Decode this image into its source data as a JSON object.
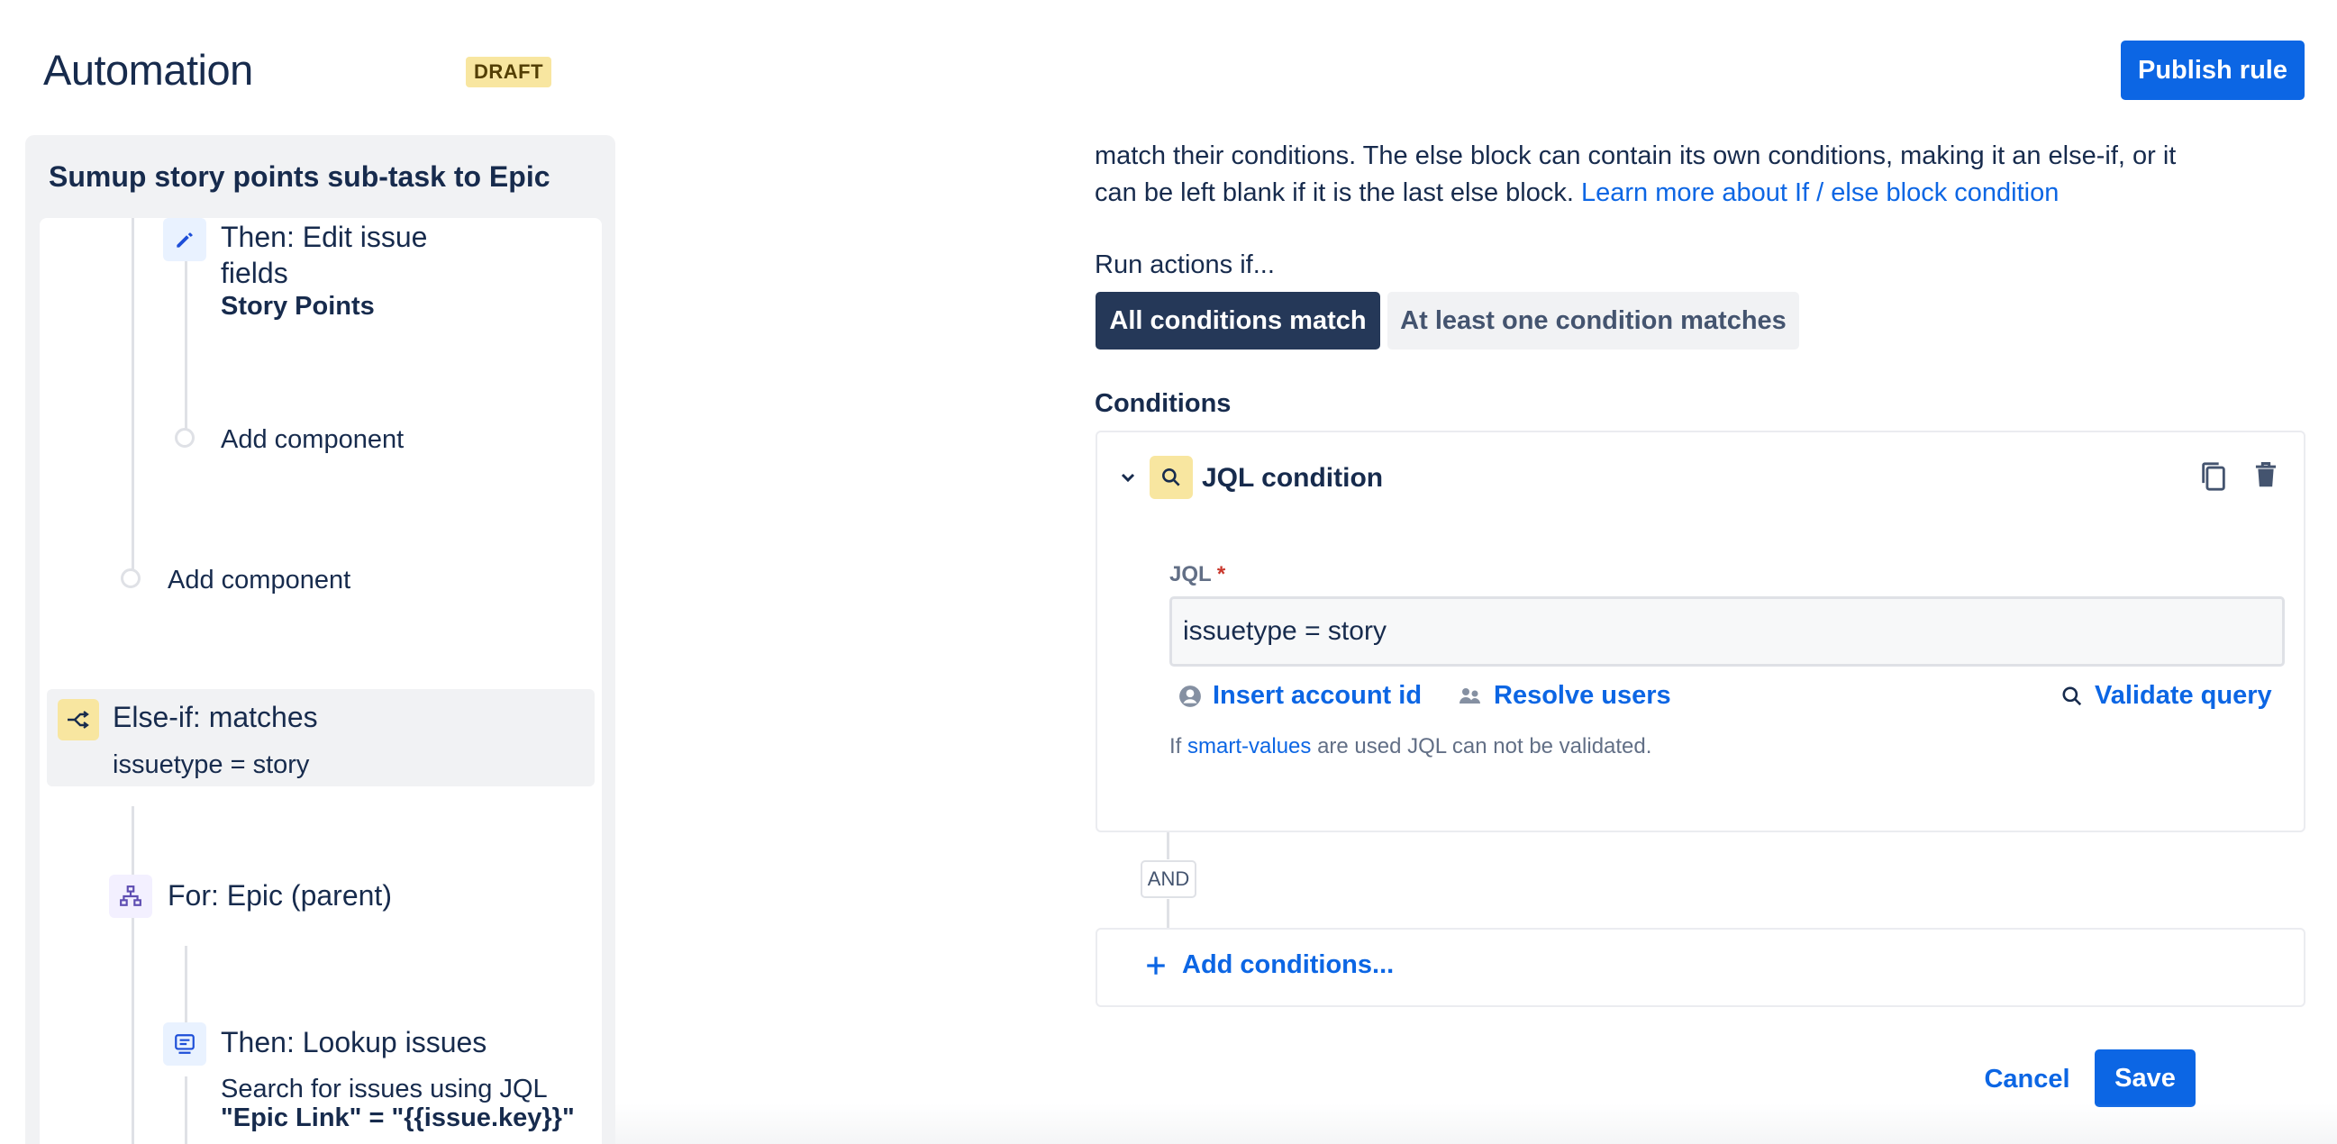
{
  "header": {
    "title": "Automation",
    "status_badge": "DRAFT",
    "publish_label": "Publish rule"
  },
  "rule": {
    "name": "Sumup story points sub-task to Epic",
    "components": [
      {
        "line1": "Then: Edit issue",
        "line2": "fields",
        "detail": "Story Points",
        "icon": "pencil-icon"
      },
      {
        "label": "Add component"
      },
      {
        "label": "Add component"
      },
      {
        "title": "Else-if: matches",
        "detail": "issuetype = story",
        "icon": "branch-icon"
      },
      {
        "title": "For: Epic (parent)",
        "icon": "hierarchy-icon"
      },
      {
        "title": "Then: Lookup issues",
        "detail": "Search for issues using JQL",
        "detail2": "\"Epic Link\" = \"{{issue.key}}\"",
        "icon": "lookup-icon"
      }
    ]
  },
  "config": {
    "description_line1": "match their conditions. The else block can contain its own conditions, making it an else-if, or it",
    "description_line2": "can be left blank if it is the last else block.",
    "learn_more": "Learn more about If / else block condition",
    "run_actions_label": "Run actions if...",
    "match_options": [
      "All conditions match",
      "At least one condition matches"
    ],
    "selected_match": "All conditions match",
    "conditions_label": "Conditions",
    "condition": {
      "title": "JQL condition",
      "jql_label": "JQL",
      "required_mark": "*",
      "jql_value": "issuetype = story",
      "insert_account": "Insert account id",
      "resolve_users": "Resolve users",
      "validate_query": "Validate query",
      "hint_prefix": "If",
      "hint_link": "smart-values",
      "hint_suffix": "are used JQL can not be validated."
    },
    "and_label": "AND",
    "add_conditions": "Add conditions...",
    "cancel_label": "Cancel",
    "save_label": "Save"
  },
  "colors": {
    "primary": "#0c66e4",
    "dark": "#253858",
    "draft_bg": "#f8e6a0"
  }
}
